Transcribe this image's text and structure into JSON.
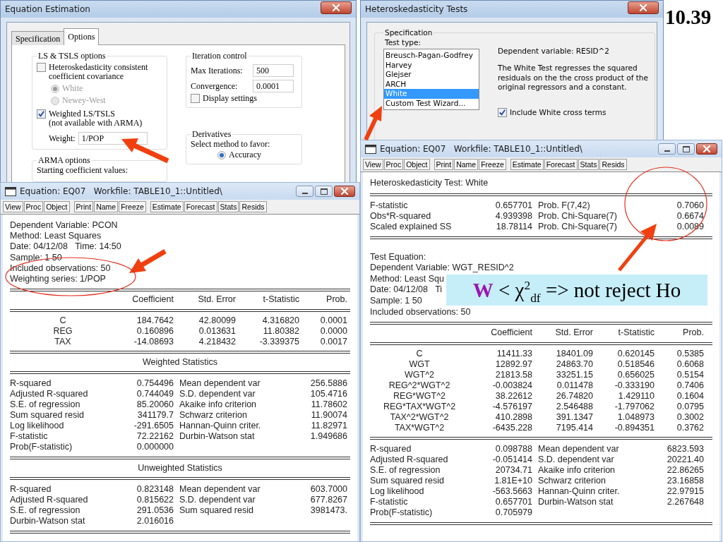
{
  "slide_number": "10.39",
  "estimation_dialog": {
    "title": "Equation Estimation",
    "tabs": [
      {
        "label": "Specification",
        "selected": false
      },
      {
        "label": "Options",
        "selected": true
      }
    ],
    "ls_group": {
      "title": "LS & TSLS options",
      "hac": {
        "label": "Heteroskedasticity consistent coefficient covariance",
        "checked": false
      },
      "radios": [
        {
          "label": "White",
          "selected": true,
          "disabled": true
        },
        {
          "label": "Newey-West",
          "selected": false,
          "disabled": true
        }
      ],
      "weighted": {
        "label": "Weighted LS/TSLS",
        "note": "(not available with ARMA)",
        "checked": true
      },
      "weight": {
        "label": "Weight:",
        "value": "1/POP"
      }
    },
    "iteration": {
      "title": "Iteration control",
      "max_label": "Max Iterations:",
      "max_value": "500",
      "conv_label": "Convergence:",
      "conv_value": "0.0001",
      "display": {
        "label": "Display settings",
        "checked": false
      }
    },
    "arma": {
      "title": "ARMA options",
      "text": "Starting coefficient values:"
    },
    "derivatives": {
      "title": "Derivatives",
      "text": "Select method to favor:",
      "radio": {
        "label": "Accuracy",
        "selected": true
      }
    }
  },
  "het_dialog": {
    "title": "Heteroskedasticity Tests",
    "group_title": "Specification",
    "test_type_label": "Test type:",
    "tests": [
      {
        "label": "Breusch-Pagan-Godfrey",
        "selected": false
      },
      {
        "label": "Harvey",
        "selected": false
      },
      {
        "label": "Glejser",
        "selected": false
      },
      {
        "label": "ARCH",
        "selected": false
      },
      {
        "label": "White",
        "selected": true
      },
      {
        "label": "Custom Test Wizard...",
        "selected": false
      }
    ],
    "dependent": "Dependent variable: RESID^2",
    "description": "The White Test regresses the squared residuals on the the cross product of the original regressors and a constant.",
    "cross_terms": {
      "label": "Include White cross terms",
      "checked": true
    }
  },
  "equation_windows": [
    {
      "title": "Equation: EQ07   Workfile: TABLE10_1::Untitled\\",
      "toolbar": [
        [
          "View",
          "Proc",
          "Object"
        ],
        [
          "Print",
          "Name",
          "Freeze"
        ],
        [
          "Estimate",
          "Forecast",
          "Stats",
          "Resids"
        ]
      ],
      "sections": [
        {
          "kind": "lines",
          "lines": [
            "Dependent Variable: PCON",
            "Method: Least Squares",
            "Date: 04/12/08   Time: 14:50",
            "Sample: 1 50",
            "Included observations: 50",
            "Weighting series: 1/POP"
          ]
        },
        {
          "kind": "coef",
          "columns": [
            "",
            "Coefficient",
            "Std. Error",
            "t-Statistic",
            "Prob."
          ],
          "rows": [
            [
              "C",
              "184.7642",
              "42.80099",
              "4.316820",
              "0.0001"
            ],
            [
              "REG",
              "0.160896",
              "0.013631",
              "11.80382",
              "0.0000"
            ],
            [
              "TAX",
              "-14.08693",
              "4.218432",
              "-3.339375",
              "0.0017"
            ]
          ]
        },
        {
          "kind": "heading",
          "text": "Weighted Statistics"
        },
        {
          "kind": "stats",
          "rows": [
            [
              "R-squared",
              "0.754496",
              "Mean dependent var",
              "256.5886"
            ],
            [
              "Adjusted R-squared",
              "0.744049",
              "S.D. dependent var",
              "105.4716"
            ],
            [
              "S.E. of regression",
              "85.20060",
              "Akaike info criterion",
              "11.78602"
            ],
            [
              "Sum squared resid",
              "341179.7",
              "Schwarz criterion",
              "11.90074"
            ],
            [
              "Log likelihood",
              "-291.6505",
              "Hannan-Quinn criter.",
              "11.82971"
            ],
            [
              "F-statistic",
              "72.22162",
              "Durbin-Watson stat",
              "1.949686"
            ],
            [
              "Prob(F-statistic)",
              "0.000000"
            ]
          ]
        },
        {
          "kind": "heading",
          "text": "Unweighted Statistics"
        },
        {
          "kind": "stats",
          "rows": [
            [
              "R-squared",
              "0.823148",
              "Mean dependent var",
              "603.7000"
            ],
            [
              "Adjusted R-squared",
              "0.815622",
              "S.D. dependent var",
              "677.8267"
            ],
            [
              "S.E. of regression",
              "291.0536",
              "Sum squared resid",
              "3981473."
            ],
            [
              "Durbin-Watson stat",
              "2.016016"
            ]
          ]
        }
      ]
    },
    {
      "title": "Equation: EQ07   Workfile: TABLE10_1::Untitled\\",
      "toolbar": [
        [
          "View",
          "Proc",
          "Object"
        ],
        [
          "Print",
          "Name",
          "Freeze"
        ],
        [
          "Estimate",
          "Forecast",
          "Stats",
          "Resids"
        ]
      ],
      "sections": [
        {
          "kind": "lines",
          "lines": [
            "Heteroskedasticity Test: White"
          ]
        },
        {
          "kind": "stats",
          "rows": [
            [
              "F-statistic",
              "0.657701",
              "Prob. F(7,42)",
              "0.7060"
            ],
            [
              "Obs*R-squared",
              "4.939398",
              "Prob. Chi-Square(7)",
              "0.6674"
            ],
            [
              "Scaled explained SS",
              "18.78114",
              "Prob. Chi-Square(7)",
              "0.0089"
            ]
          ]
        },
        {
          "kind": "lines",
          "lines": [
            "Test Equation:",
            "Dependent Variable: WGT_RESID^2",
            "Method: Least Squ",
            "Date: 04/12/08   Ti",
            "Sample: 1 50",
            "Included observations: 50"
          ]
        },
        {
          "kind": "coef",
          "columns": [
            "",
            "Coefficient",
            "Std. Error",
            "t-Statistic",
            "Prob."
          ],
          "rows": [
            [
              "C",
              "11411.33",
              "18401.09",
              "0.620145",
              "0.5385"
            ],
            [
              "WGT",
              "12892.97",
              "24863.70",
              "0.518546",
              "0.6068"
            ],
            [
              "WGT^2",
              "21813.58",
              "33251.15",
              "0.656025",
              "0.5154"
            ],
            [
              "REG^2*WGT^2",
              "-0.003824",
              "0.011478",
              "-0.333190",
              "0.7406"
            ],
            [
              "REG*WGT^2",
              "38.22612",
              "26.74820",
              "1.429110",
              "0.1604"
            ],
            [
              "REG*TAX*WGT^2",
              "-4.576197",
              "2.546488",
              "-1.797062",
              "0.0795"
            ],
            [
              "TAX^2*WGT^2",
              "410.2898",
              "391.1347",
              "1.048973",
              "0.3002"
            ],
            [
              "TAX*WGT^2",
              "-6435.228",
              "7195.414",
              "-0.894351",
              "0.3762"
            ]
          ]
        },
        {
          "kind": "stats",
          "rows": [
            [
              "R-squared",
              "0.098788",
              "Mean dependent var",
              "6823.593"
            ],
            [
              "Adjusted R-squared",
              "-0.051414",
              "S.D. dependent var",
              "20221.40"
            ],
            [
              "S.E. of regression",
              "20734.71",
              "Akaike info criterion",
              "22.86265"
            ],
            [
              "Sum squared resid",
              "1.81E+10",
              "Schwarz criterion",
              "23.16858"
            ],
            [
              "Log likelihood",
              "-563.5663",
              "Hannan-Quinn criter.",
              "22.97915"
            ],
            [
              "F-statistic",
              "0.657701",
              "Durbin-Watson stat",
              "2.267648"
            ],
            [
              "Prob(F-statistic)",
              "0.705979"
            ]
          ]
        }
      ]
    }
  ],
  "callout": {
    "text": "**W** < χ$^{2}$$_{df}$ => not reject Ho"
  }
}
